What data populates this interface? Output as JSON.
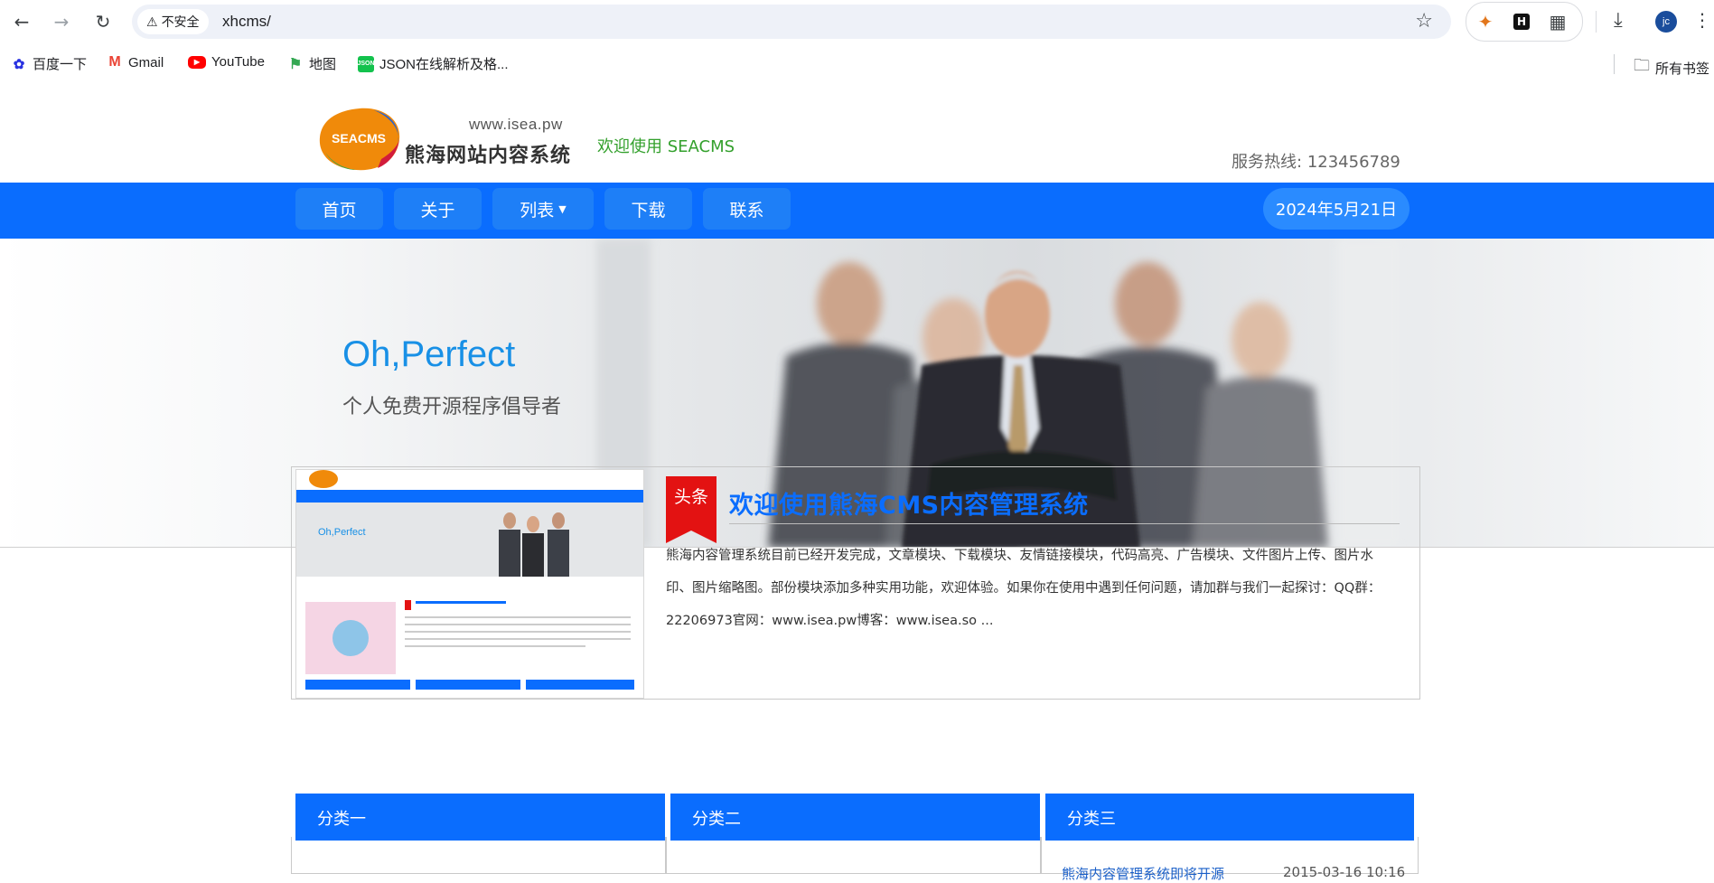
{
  "browser": {
    "security_label": "不安全",
    "url": "xhcms/",
    "avatar_initials": "jc",
    "bookmarks": [
      {
        "label": "百度一下",
        "icon": "baidu-icon"
      },
      {
        "label": "Gmail",
        "icon": "gmail-icon"
      },
      {
        "label": "YouTube",
        "icon": "youtube-icon"
      },
      {
        "label": "地图",
        "icon": "maps-icon"
      },
      {
        "label": "JSON在线解析及格...",
        "icon": "json-icon"
      }
    ],
    "all_bookmarks_label": "所有书签"
  },
  "header": {
    "logo_badge": "SEACMS",
    "logo_url": "www.isea.pw",
    "logo_name": "熊海网站内容系统",
    "welcome": "欢迎使用 SEACMS",
    "hotline_label": "服务热线:",
    "hotline_number": "123456789"
  },
  "nav": {
    "items": [
      {
        "label": "首页"
      },
      {
        "label": "关于"
      },
      {
        "label": "列表",
        "has_dropdown": true
      },
      {
        "label": "下载"
      },
      {
        "label": "联系"
      }
    ],
    "date": "2024年5月21日"
  },
  "banner": {
    "title": "Oh,Perfect",
    "subtitle": "个人免费开源程序倡导者"
  },
  "headline": {
    "tag": "头条",
    "title": "欢迎使用熊海CMS内容管理系统",
    "body": "熊海内容管理系统目前已经开发完成，文章模块、下载模块、友情链接模块，代码高亮、广告模块、文件图片上传、图片水印、图片缩略图。部份模块添加多种实用功能，欢迎体验。如果你在使用中遇到任何问题，请加群与我们一起探讨：QQ群：22206973官网：www.isea.pw博客：www.isea.so ..."
  },
  "categories": [
    {
      "label": "分类一"
    },
    {
      "label": "分类二"
    },
    {
      "label": "分类三"
    }
  ],
  "category3_first": {
    "title": "熊海内容管理系统即将开源",
    "time": "2015-03-16 10:16"
  },
  "colors": {
    "nav_blue": "#0a6dfe",
    "welcome_green": "#33a02c",
    "banner_title_blue": "#1890e6",
    "tag_red": "#e31212"
  }
}
